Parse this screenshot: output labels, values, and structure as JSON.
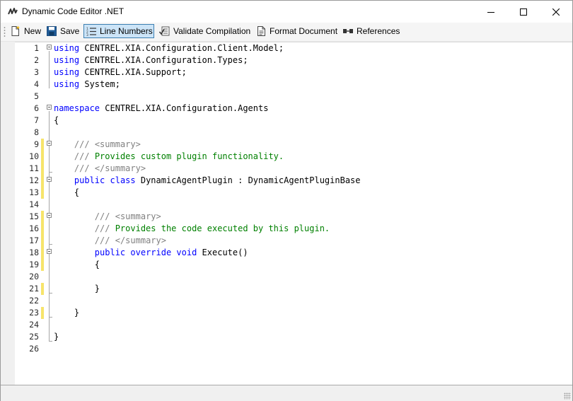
{
  "window": {
    "title": "Dynamic Code Editor .NET"
  },
  "toolbar": {
    "new_label": "New",
    "save_label": "Save",
    "line_numbers_label": "Line Numbers",
    "validate_label": "Validate Compilation",
    "format_label": "Format Document",
    "references_label": "References"
  },
  "colors": {
    "keyword": "#0000ff",
    "comment": "#008000",
    "comment_tag": "#808080",
    "modified_marker": "#f7e46a",
    "active_button_bg": "#cce4f7"
  },
  "editor": {
    "lines": [
      {
        "n": "1",
        "tokens": [
          {
            "t": "using",
            "c": "kw"
          },
          {
            "t": " CENTREL.XIA.Configuration.Client.Model;",
            "c": ""
          }
        ]
      },
      {
        "n": "2",
        "tokens": [
          {
            "t": "using",
            "c": "kw"
          },
          {
            "t": " CENTREL.XIA.Configuration.Types;",
            "c": ""
          }
        ]
      },
      {
        "n": "3",
        "tokens": [
          {
            "t": "using",
            "c": "kw"
          },
          {
            "t": " CENTREL.XIA.Support;",
            "c": ""
          }
        ]
      },
      {
        "n": "4",
        "tokens": [
          {
            "t": "using",
            "c": "kw"
          },
          {
            "t": " System;",
            "c": ""
          }
        ]
      },
      {
        "n": "5",
        "tokens": []
      },
      {
        "n": "6",
        "tokens": [
          {
            "t": "namespace",
            "c": "kw"
          },
          {
            "t": " CENTREL.XIA.Configuration.Agents",
            "c": ""
          }
        ]
      },
      {
        "n": "7",
        "tokens": [
          {
            "t": "{",
            "c": ""
          }
        ]
      },
      {
        "n": "8",
        "tokens": []
      },
      {
        "n": "9",
        "tokens": [
          {
            "t": "    ",
            "c": ""
          },
          {
            "t": "///",
            "c": "cg"
          },
          {
            "t": " ",
            "c": "cm"
          },
          {
            "t": "<summary>",
            "c": "cg"
          }
        ]
      },
      {
        "n": "10",
        "tokens": [
          {
            "t": "    ",
            "c": ""
          },
          {
            "t": "///",
            "c": "cg"
          },
          {
            "t": " Provides custom plugin functionality.",
            "c": "cm"
          }
        ]
      },
      {
        "n": "11",
        "tokens": [
          {
            "t": "    ",
            "c": ""
          },
          {
            "t": "///",
            "c": "cg"
          },
          {
            "t": " ",
            "c": "cm"
          },
          {
            "t": "</summary>",
            "c": "cg"
          }
        ]
      },
      {
        "n": "12",
        "tokens": [
          {
            "t": "    ",
            "c": ""
          },
          {
            "t": "public",
            "c": "kw"
          },
          {
            "t": " ",
            "c": ""
          },
          {
            "t": "class",
            "c": "kw"
          },
          {
            "t": " DynamicAgentPlugin : DynamicAgentPluginBase",
            "c": ""
          }
        ]
      },
      {
        "n": "13",
        "tokens": [
          {
            "t": "    {",
            "c": ""
          }
        ]
      },
      {
        "n": "14",
        "tokens": []
      },
      {
        "n": "15",
        "tokens": [
          {
            "t": "        ",
            "c": ""
          },
          {
            "t": "///",
            "c": "cg"
          },
          {
            "t": " ",
            "c": "cm"
          },
          {
            "t": "<summary>",
            "c": "cg"
          }
        ]
      },
      {
        "n": "16",
        "tokens": [
          {
            "t": "        ",
            "c": ""
          },
          {
            "t": "///",
            "c": "cg"
          },
          {
            "t": " Provides the code executed by this plugin.",
            "c": "cm"
          }
        ]
      },
      {
        "n": "17",
        "tokens": [
          {
            "t": "        ",
            "c": ""
          },
          {
            "t": "///",
            "c": "cg"
          },
          {
            "t": " ",
            "c": "cm"
          },
          {
            "t": "</summary>",
            "c": "cg"
          }
        ]
      },
      {
        "n": "18",
        "tokens": [
          {
            "t": "        ",
            "c": ""
          },
          {
            "t": "public",
            "c": "kw"
          },
          {
            "t": " ",
            "c": ""
          },
          {
            "t": "override",
            "c": "kw"
          },
          {
            "t": " ",
            "c": ""
          },
          {
            "t": "void",
            "c": "kw"
          },
          {
            "t": " Execute()",
            "c": ""
          }
        ]
      },
      {
        "n": "19",
        "tokens": [
          {
            "t": "        {",
            "c": ""
          }
        ]
      },
      {
        "n": "20",
        "tokens": []
      },
      {
        "n": "21",
        "tokens": [
          {
            "t": "        }",
            "c": ""
          }
        ]
      },
      {
        "n": "22",
        "tokens": []
      },
      {
        "n": "23",
        "tokens": [
          {
            "t": "    }",
            "c": ""
          }
        ]
      },
      {
        "n": "24",
        "tokens": []
      },
      {
        "n": "25",
        "tokens": [
          {
            "t": "}",
            "c": ""
          }
        ]
      },
      {
        "n": "26",
        "tokens": []
      }
    ]
  }
}
